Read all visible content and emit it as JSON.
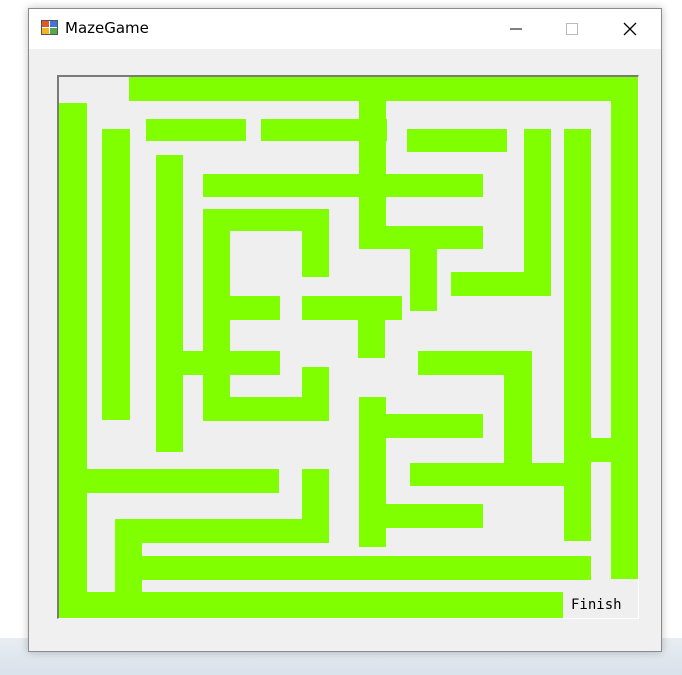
{
  "window": {
    "title": "MazeGame",
    "icon": "winforms-app-icon",
    "controls": [
      "minimize-icon",
      "maximize-icon",
      "close-icon"
    ]
  },
  "maze": {
    "wall_color": "#7fff00",
    "finish_label": "Finish"
  }
}
